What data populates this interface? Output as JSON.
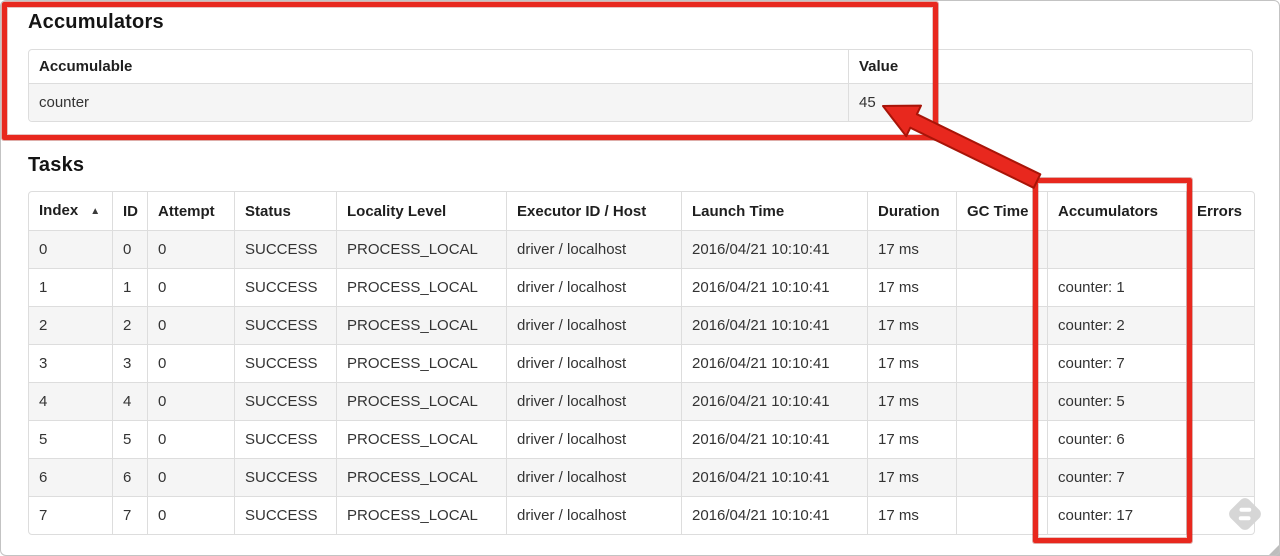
{
  "page": {
    "accumulators_heading": "Accumulators",
    "tasks_heading": "Tasks"
  },
  "accumulators_table": {
    "columns": [
      "Accumulable",
      "Value"
    ],
    "rows": [
      {
        "accumulable": "counter",
        "value": "45"
      }
    ]
  },
  "tasks_table": {
    "columns": [
      "Index",
      "ID",
      "Attempt",
      "Status",
      "Locality Level",
      "Executor ID / Host",
      "Launch Time",
      "Duration",
      "GC Time",
      "Accumulators",
      "Errors"
    ],
    "sort_icon": "▲",
    "rows": [
      {
        "index": "0",
        "id": "0",
        "attempt": "0",
        "status": "SUCCESS",
        "locality_level": "PROCESS_LOCAL",
        "executor_id_host": "driver / localhost",
        "launch_time": "2016/04/21 10:10:41",
        "duration": "17 ms",
        "gc_time": "",
        "accumulators": "",
        "errors": ""
      },
      {
        "index": "1",
        "id": "1",
        "attempt": "0",
        "status": "SUCCESS",
        "locality_level": "PROCESS_LOCAL",
        "executor_id_host": "driver / localhost",
        "launch_time": "2016/04/21 10:10:41",
        "duration": "17 ms",
        "gc_time": "",
        "accumulators": "counter: 1",
        "errors": ""
      },
      {
        "index": "2",
        "id": "2",
        "attempt": "0",
        "status": "SUCCESS",
        "locality_level": "PROCESS_LOCAL",
        "executor_id_host": "driver / localhost",
        "launch_time": "2016/04/21 10:10:41",
        "duration": "17 ms",
        "gc_time": "",
        "accumulators": "counter: 2",
        "errors": ""
      },
      {
        "index": "3",
        "id": "3",
        "attempt": "0",
        "status": "SUCCESS",
        "locality_level": "PROCESS_LOCAL",
        "executor_id_host": "driver / localhost",
        "launch_time": "2016/04/21 10:10:41",
        "duration": "17 ms",
        "gc_time": "",
        "accumulators": "counter: 7",
        "errors": ""
      },
      {
        "index": "4",
        "id": "4",
        "attempt": "0",
        "status": "SUCCESS",
        "locality_level": "PROCESS_LOCAL",
        "executor_id_host": "driver / localhost",
        "launch_time": "2016/04/21 10:10:41",
        "duration": "17 ms",
        "gc_time": "",
        "accumulators": "counter: 5",
        "errors": ""
      },
      {
        "index": "5",
        "id": "5",
        "attempt": "0",
        "status": "SUCCESS",
        "locality_level": "PROCESS_LOCAL",
        "executor_id_host": "driver / localhost",
        "launch_time": "2016/04/21 10:10:41",
        "duration": "17 ms",
        "gc_time": "",
        "accumulators": "counter: 6",
        "errors": ""
      },
      {
        "index": "6",
        "id": "6",
        "attempt": "0",
        "status": "SUCCESS",
        "locality_level": "PROCESS_LOCAL",
        "executor_id_host": "driver / localhost",
        "launch_time": "2016/04/21 10:10:41",
        "duration": "17 ms",
        "gc_time": "",
        "accumulators": "counter: 7",
        "errors": ""
      },
      {
        "index": "7",
        "id": "7",
        "attempt": "0",
        "status": "SUCCESS",
        "locality_level": "PROCESS_LOCAL",
        "executor_id_host": "driver / localhost",
        "launch_time": "2016/04/21 10:10:41",
        "duration": "17 ms",
        "gc_time": "",
        "accumulators": "counter: 17",
        "errors": ""
      }
    ]
  },
  "annotations": {
    "color": "#e8281e",
    "outline_color": "#a81408"
  }
}
